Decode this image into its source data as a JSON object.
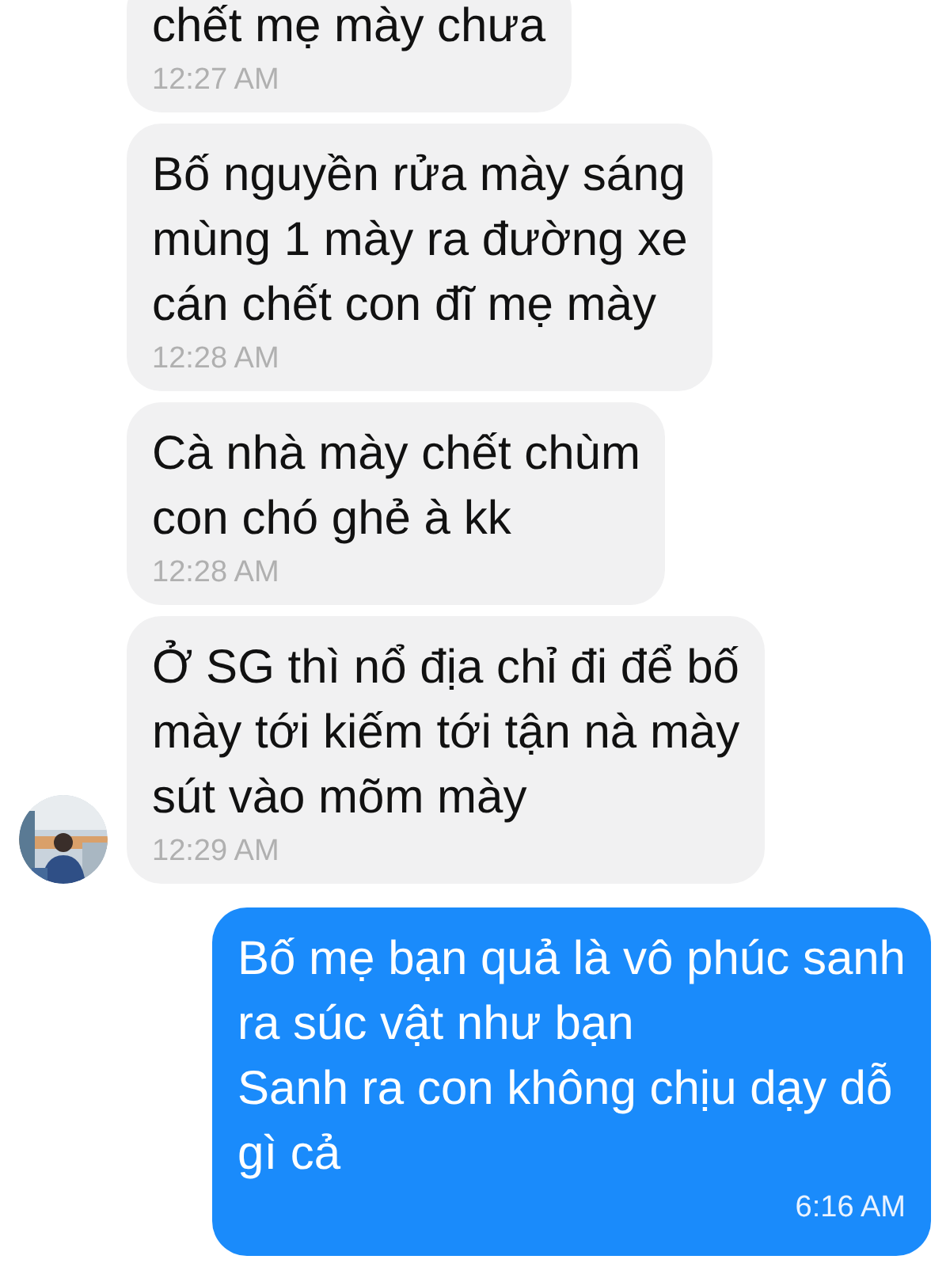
{
  "messages": [
    {
      "kind": "incoming",
      "show_avatar": false,
      "lines": [
        "chết mẹ mày chưa"
      ],
      "time": "12:27 AM"
    },
    {
      "kind": "incoming",
      "show_avatar": false,
      "lines": [
        "Bố nguyền rửa mày sáng",
        "mùng 1 mày ra đường xe",
        "cán chết con đĩ mẹ mày"
      ],
      "time": "12:28 AM"
    },
    {
      "kind": "incoming",
      "show_avatar": false,
      "lines": [
        "Cà nhà mày chết chùm",
        "con chó ghẻ à kk"
      ],
      "time": "12:28 AM"
    },
    {
      "kind": "incoming",
      "show_avatar": true,
      "lines": [
        "Ở SG thì nổ địa chỉ đi để bố",
        "mày tới kiếm tới tận nà mày",
        "sút vào mõm mày"
      ],
      "time": "12:29 AM"
    },
    {
      "kind": "outgoing",
      "lines": [
        "Bố mẹ bạn quả là vô phúc sanh",
        "ra súc vật như bạn",
        "Sanh ra con không chịu dạy dỗ",
        "gì cả"
      ],
      "time": "6:16 AM"
    }
  ]
}
